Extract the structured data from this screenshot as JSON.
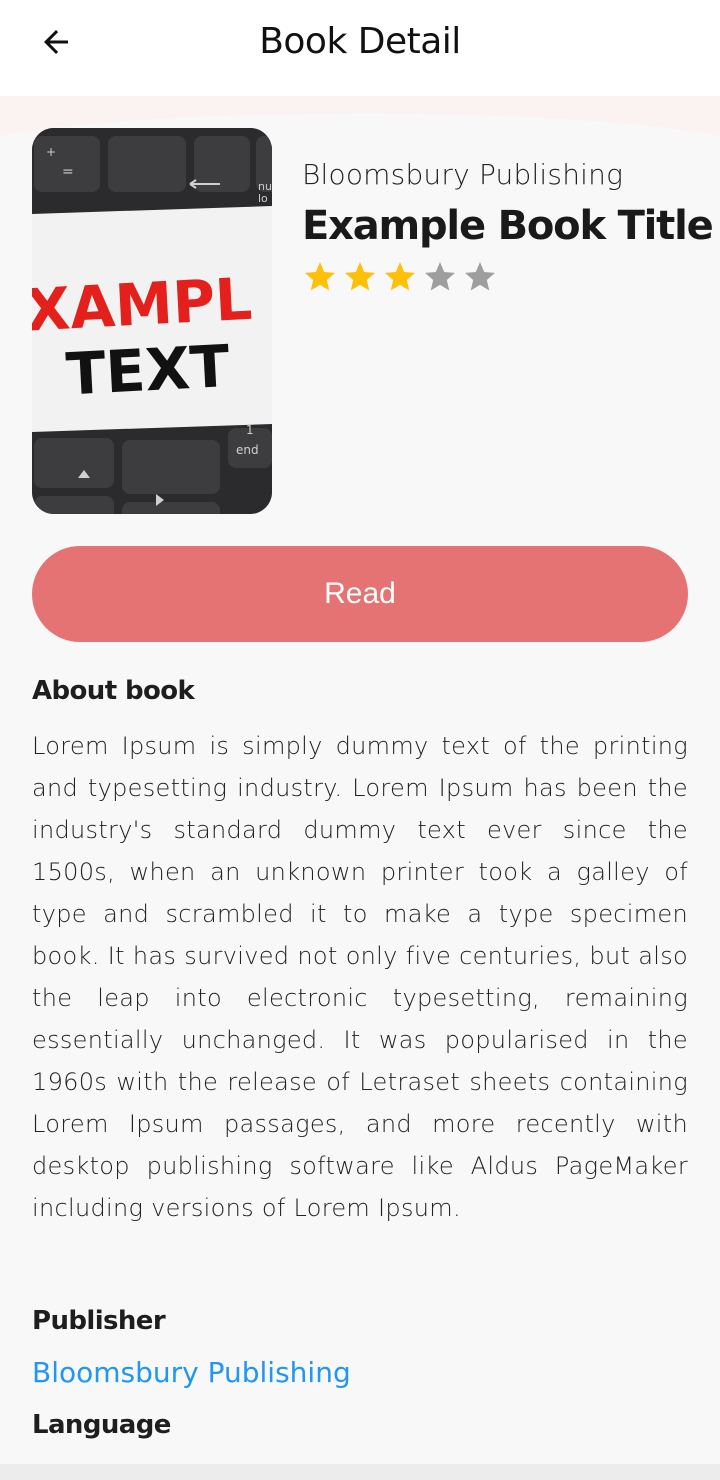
{
  "app_bar": {
    "title": "Book Detail",
    "back_icon": "arrow-left-icon"
  },
  "book": {
    "publisher": "Bloomsbury Publishing",
    "title": "Example Book Title",
    "rating": 3,
    "rating_max": 5,
    "cover_text_line1": "XAMPL",
    "cover_text_line2": "TEXT",
    "cover_key_nu": "nu",
    "cover_key_lo": "lo",
    "cover_key_1": "1",
    "cover_key_end": "end"
  },
  "actions": {
    "read_label": "Read"
  },
  "about": {
    "heading": "About book",
    "text": "Lorem Ipsum is simply dummy text of the printing and typesetting industry. Lorem Ipsum has been the industry's standard dummy text ever since the 1500s, when an unknown printer took a galley of type and scrambled it to make a type specimen book. It has survived not only five centuries, but also the leap into electronic typesetting, remaining essentially unchanged. It was popularised in the 1960s with the release of Letraset sheets containing Lorem Ipsum passages, and more recently with desktop publishing software like Aldus PageMaker including versions of Lorem Ipsum."
  },
  "details": {
    "publisher_heading": "Publisher",
    "publisher_value": "Bloomsbury Publishing",
    "language_heading": "Language"
  },
  "colors": {
    "accent": "#e57373",
    "link": "#2196f3",
    "star_filled": "#ffc107",
    "star_empty": "#9e9e9e",
    "background": "#f8f8f8"
  }
}
